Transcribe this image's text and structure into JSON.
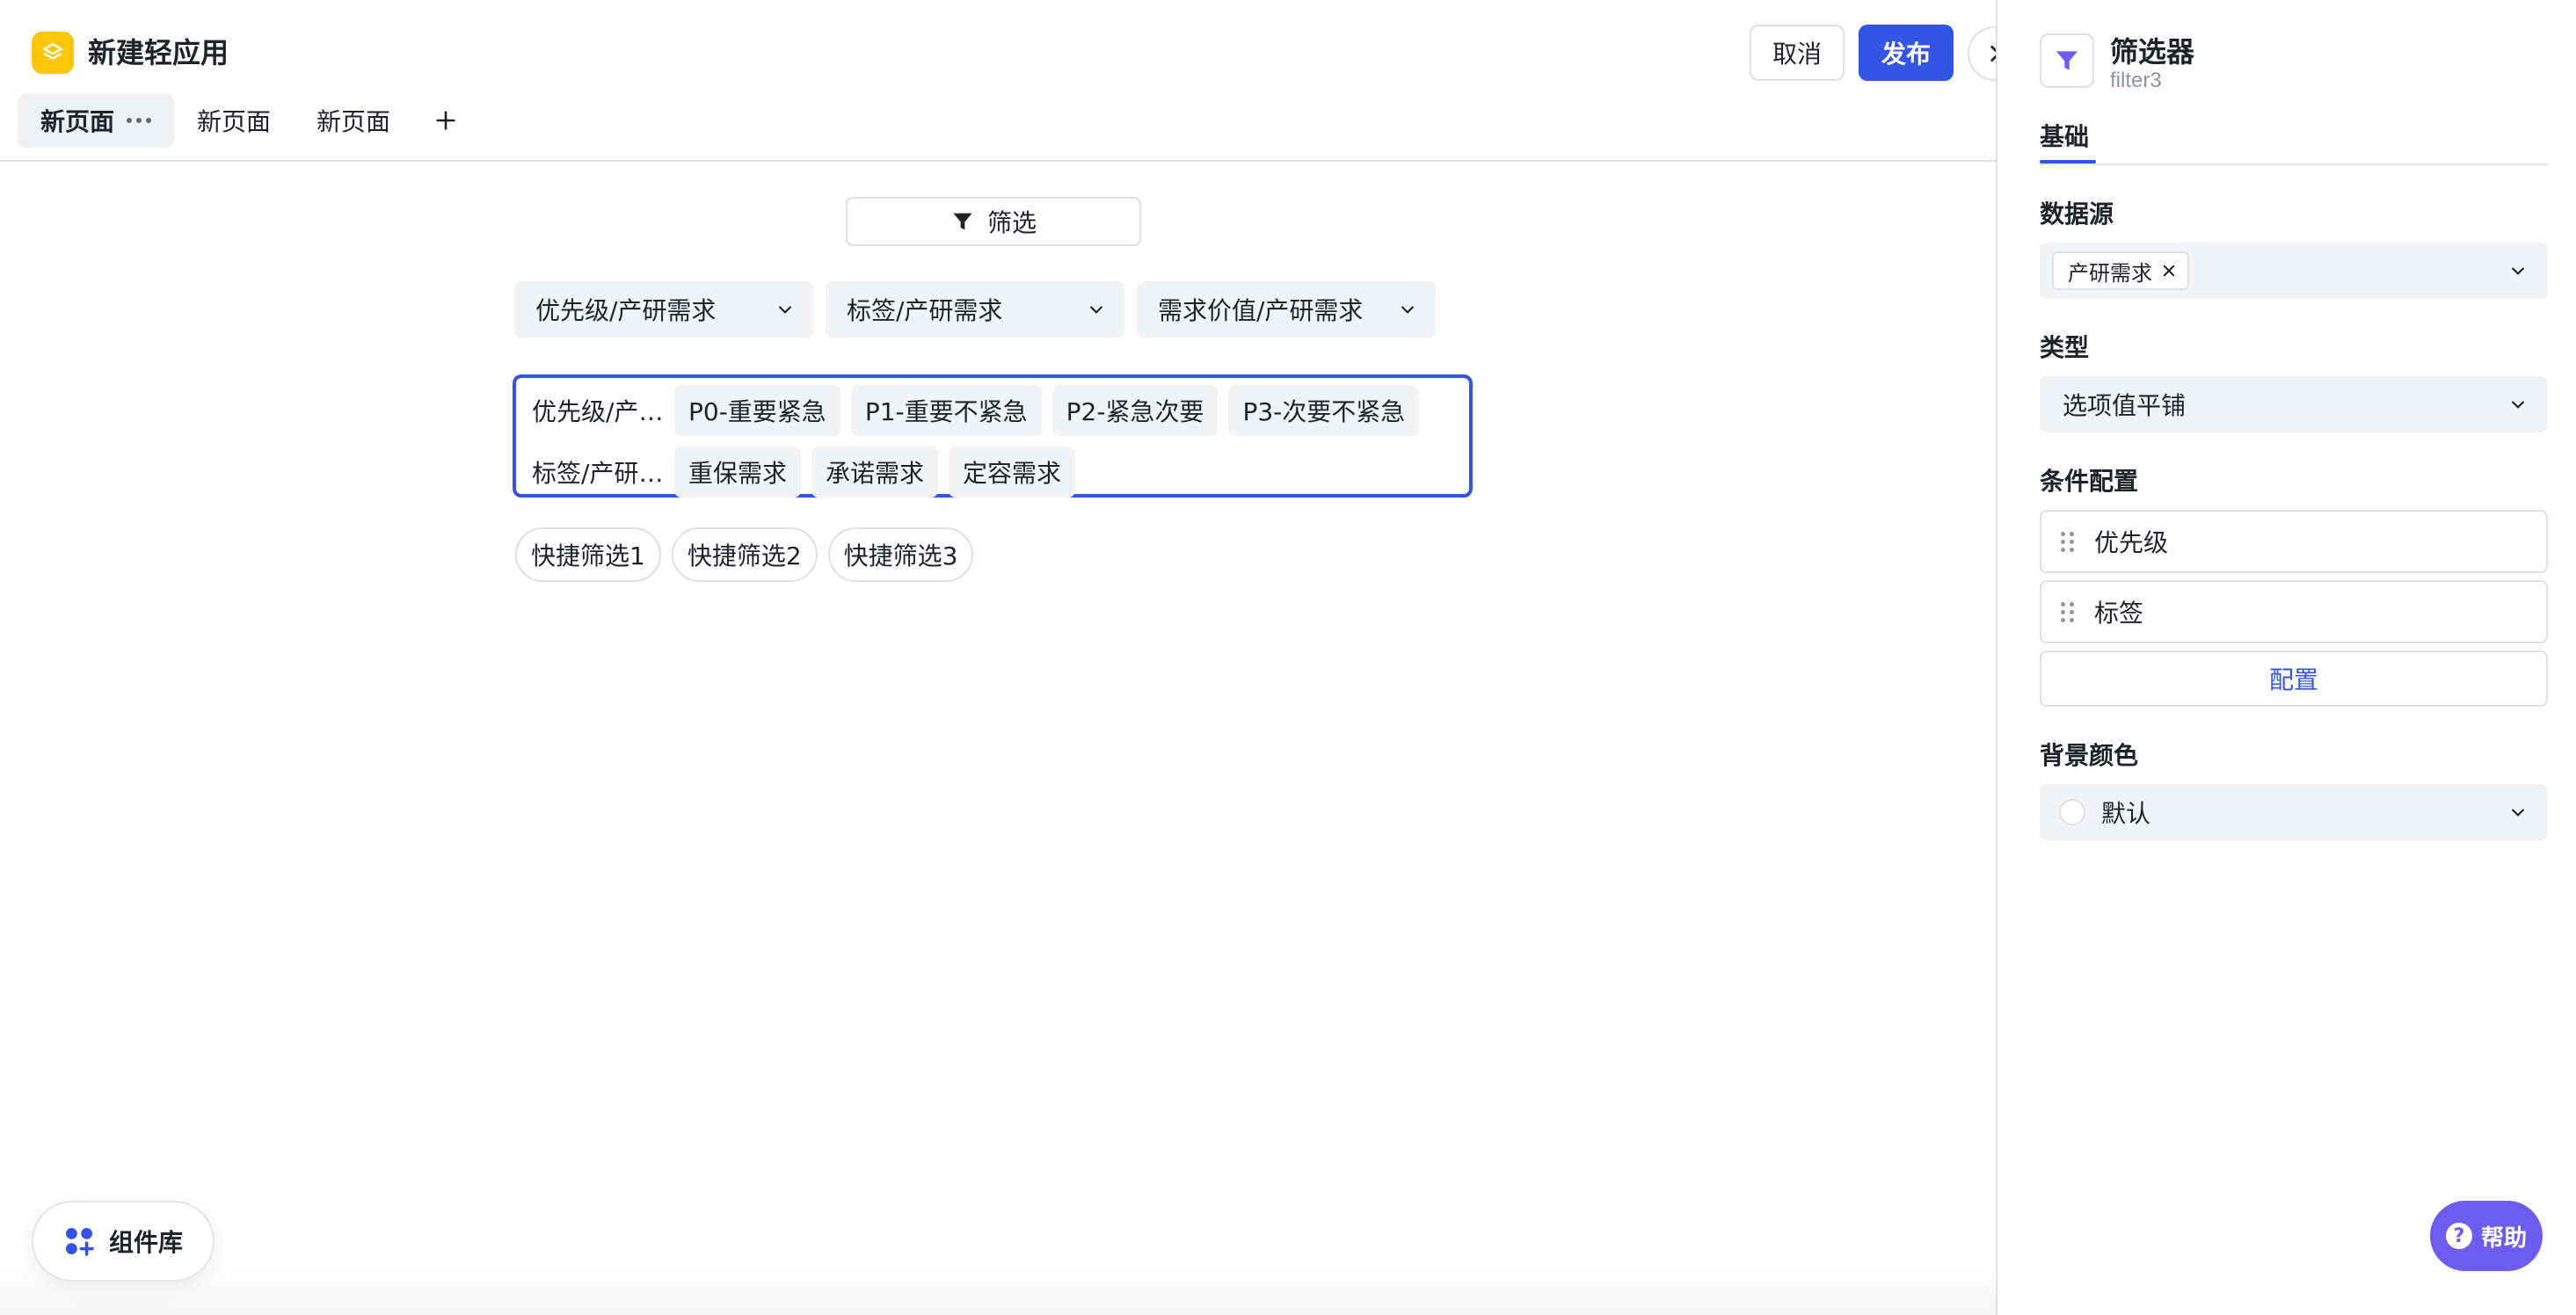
{
  "app": {
    "title": "新建轻应用",
    "logo_icon": "layers-icon",
    "accent_color": "#3355e6",
    "logo_color": "#ffc60a"
  },
  "header": {
    "cancel_label": "取消",
    "publish_label": "发布"
  },
  "tabs": [
    {
      "label": "新页面",
      "active": true
    },
    {
      "label": "新页面",
      "active": false
    },
    {
      "label": "新页面",
      "active": false
    }
  ],
  "canvas": {
    "filter_button_label": "筛选",
    "dropdowns": [
      {
        "label": "优先级/产研需求"
      },
      {
        "label": "标签/产研需求"
      },
      {
        "label": "需求价值/产研需求"
      }
    ],
    "filter_rows": [
      {
        "label": "优先级/产研需求",
        "options": [
          "P0-重要紧急",
          "P1-重要不紧急",
          "P2-紧急次要",
          "P3-次要不紧急"
        ]
      },
      {
        "label": "标签/产研需求",
        "options": [
          "重保需求",
          "承诺需求",
          "定容需求"
        ]
      }
    ],
    "quick_filters": [
      "快捷筛选1",
      "快捷筛选2",
      "快捷筛选3"
    ],
    "component_library_label": "组件库"
  },
  "panel": {
    "title": "筛选器",
    "subtitle": "filter3",
    "tab_label": "基础",
    "datasource": {
      "label": "数据源",
      "tag": "产研需求"
    },
    "type": {
      "label": "类型",
      "value": "选项值平铺"
    },
    "conditions": {
      "label": "条件配置",
      "items": [
        "优先级",
        "标签"
      ],
      "config_button": "配置"
    },
    "background": {
      "label": "背景颜色",
      "value": "默认"
    },
    "help_label": "帮助"
  }
}
